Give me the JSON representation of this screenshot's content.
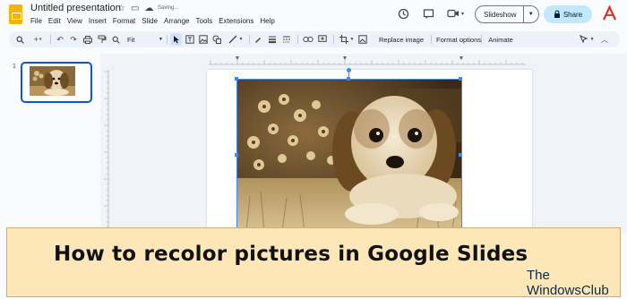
{
  "app": {
    "title": "Untitled presentation",
    "status": "Saving...",
    "header_icons": [
      "star-icon",
      "folder-move-icon",
      "cloud-icon"
    ]
  },
  "menu": {
    "items": [
      "File",
      "Edit",
      "View",
      "Insert",
      "Format",
      "Slide",
      "Arrange",
      "Tools",
      "Extensions",
      "Help"
    ]
  },
  "header_actions": {
    "slideshow_label": "Slideshow",
    "share_label": "Share",
    "brand_letter": "A"
  },
  "toolbar": {
    "zoom_label": "Fit",
    "replace_image_label": "Replace image",
    "format_options_label": "Format options",
    "animate_label": "Animate"
  },
  "filmstrip": {
    "slides": [
      {
        "number": "1"
      }
    ]
  },
  "banner": {
    "headline": "How to recolor pictures in Google Slides",
    "watermark_line1": "The",
    "watermark_line2": "WindowsClub"
  },
  "colors": {
    "accent_blue": "#0b57d0",
    "share_bg": "#c2e7ff",
    "banner_bg": "#fde6b8",
    "logo_yellow": "#f4b400",
    "sepia": "#a3834f"
  }
}
